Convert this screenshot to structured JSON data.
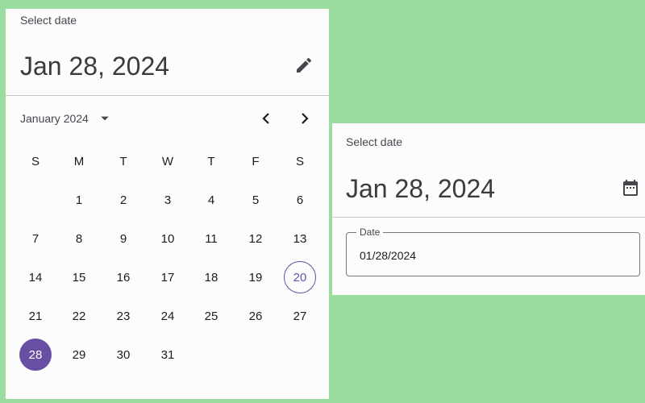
{
  "left": {
    "title": "Select date",
    "headline": "Jan 28, 2024",
    "mode_icon": "pencil-icon",
    "month_label": "January 2024",
    "weekdays": [
      "S",
      "M",
      "T",
      "W",
      "T",
      "F",
      "S"
    ],
    "weeks": [
      [
        "",
        "1",
        "2",
        "3",
        "4",
        "5",
        "6"
      ],
      [
        "7",
        "8",
        "9",
        "10",
        "11",
        "12",
        "13"
      ],
      [
        "14",
        "15",
        "16",
        "17",
        "18",
        "19",
        "20"
      ],
      [
        "21",
        "22",
        "23",
        "24",
        "25",
        "26",
        "27"
      ],
      [
        "28",
        "29",
        "30",
        "31",
        "",
        "",
        ""
      ]
    ],
    "today": "20",
    "selected": "28"
  },
  "right": {
    "title": "Select date",
    "headline": "Jan 28, 2024",
    "mode_icon": "calendar-icon",
    "field_label": "Date",
    "field_value": "01/28/2024"
  },
  "colors": {
    "accent": "#6750a4",
    "background": "#9bdd9e",
    "surface": "#fcfcfc"
  }
}
